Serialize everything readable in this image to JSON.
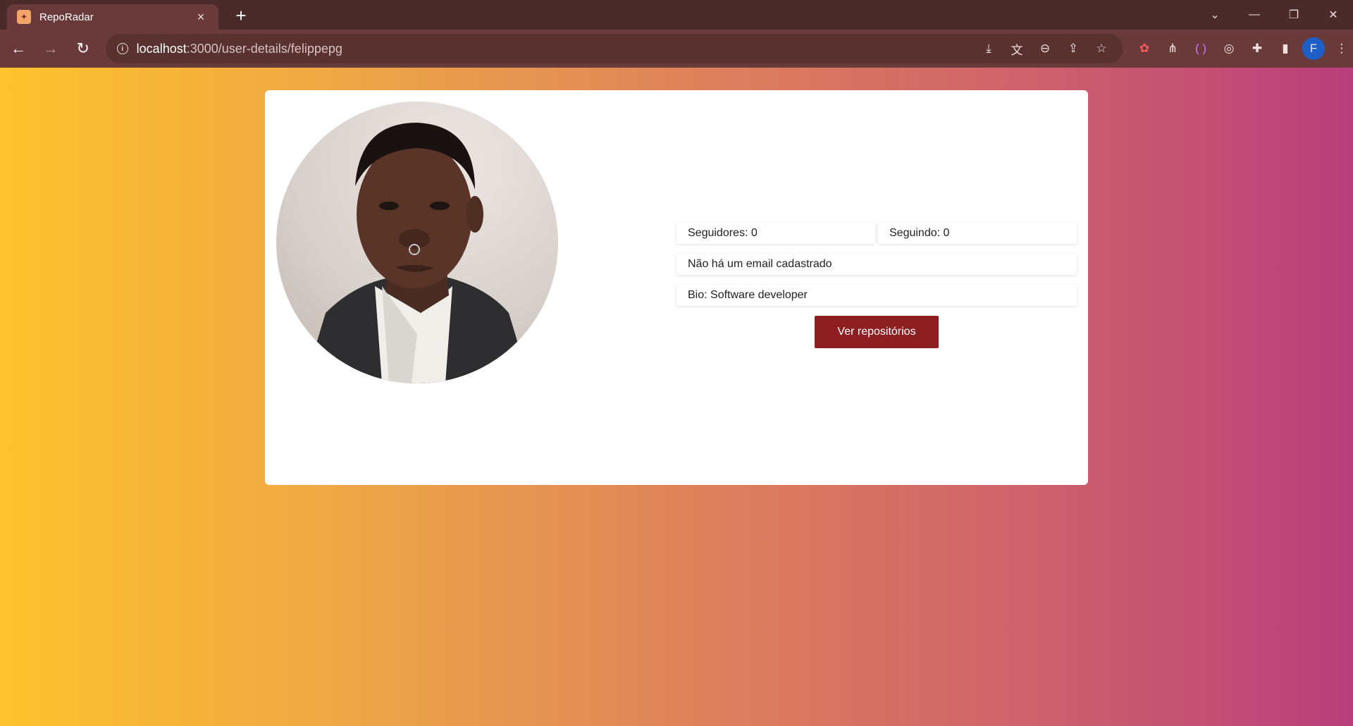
{
  "browser": {
    "tab_title": "RepoRadar",
    "tab_close": "×",
    "new_tab": "+",
    "url_host": "localhost",
    "url_path": ":3000/user-details/felippepg",
    "profile_initial": "F"
  },
  "icons": {
    "back": "back-arrow-icon",
    "forward": "forward-arrow-icon",
    "reload": "reload-icon",
    "info": "info-icon",
    "install": "install-icon",
    "translate": "translate-icon",
    "zoom": "zoom-out-icon",
    "share": "share-icon",
    "bookmark": "star-icon",
    "extensions": "puzzle-icon",
    "side_panel": "side-panel-icon",
    "menu": "kebab-menu-icon"
  },
  "profile": {
    "followers_label": "Seguidores: 0",
    "following_label": "Seguindo: 0",
    "email_text": "Não há um email cadastrado",
    "bio_text": "Bio: Software developer",
    "repos_button": "Ver repositórios"
  },
  "colors": {
    "gradient_start": "#fdc22d",
    "gradient_end": "#b93f7a",
    "button_bg": "#8d1f22",
    "chrome_bg": "#4a2a2a"
  }
}
